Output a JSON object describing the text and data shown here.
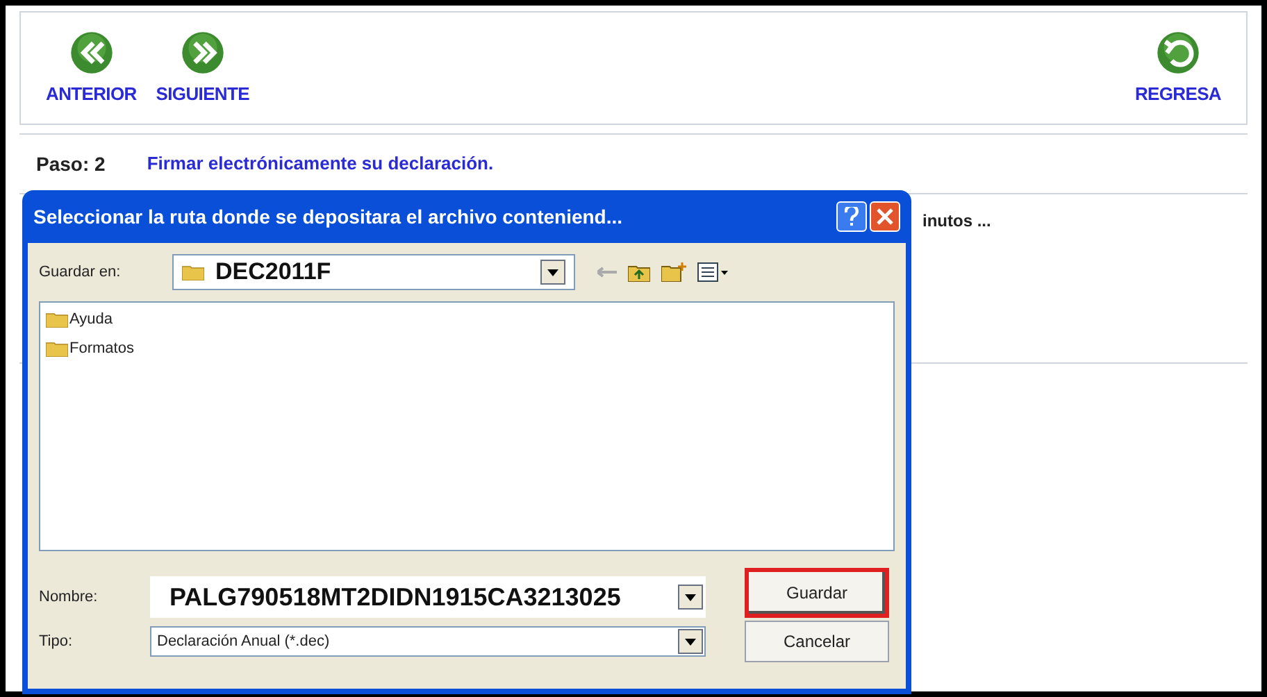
{
  "toolbar": {
    "left": [
      {
        "label": "ANTERIOR",
        "kind": "back"
      },
      {
        "label": "SIGUIENTE",
        "kind": "forward"
      }
    ],
    "right": {
      "label": "REGRESA",
      "kind": "return"
    }
  },
  "step": {
    "label": "Paso: 2",
    "title": "Firmar electrónicamente su declaración."
  },
  "partial_text": "inutos ...",
  "dialog": {
    "title": "Seleccionar la ruta donde se depositara el archivo conteniend...",
    "save_in_label": "Guardar en:",
    "save_in_value": "DEC2011F",
    "files": [
      {
        "name": "Ayuda"
      },
      {
        "name": "Formatos"
      }
    ],
    "name_label": "Nombre:",
    "name_value": "PALG790518MT2DIDN1915CA3213025",
    "type_label": "Tipo:",
    "type_value": "Declaración Anual (*.dec)",
    "buttons": [
      {
        "label": "Guardar",
        "highlighted": true
      },
      {
        "label": "Cancelar",
        "highlighted": false
      }
    ]
  }
}
